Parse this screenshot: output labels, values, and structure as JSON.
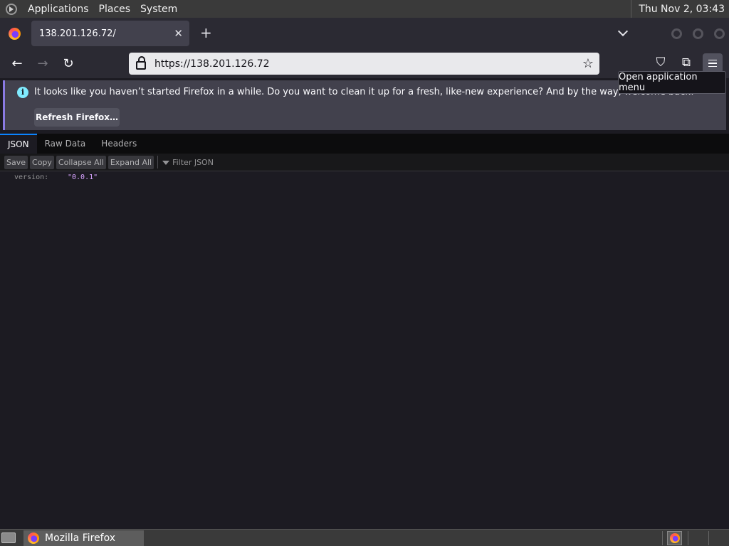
{
  "system_panel": {
    "menus": [
      "Applications",
      "Places",
      "System"
    ],
    "clock": "Thu Nov  2, 03:43"
  },
  "browser": {
    "tab_title": "138.201.126.72/",
    "tab_close": "✕",
    "new_tab": "+",
    "url": "https://138.201.126.72",
    "tooltip": "Open application menu",
    "notification": {
      "message": "It looks like you haven’t started Firefox in a while. Do you want to clean it up for a fresh, like-new experience? And by the way, welcome back!",
      "button_label": "Refresh Firefox…"
    }
  },
  "json_viewer": {
    "tabs": [
      "JSON",
      "Raw Data",
      "Headers"
    ],
    "active_tab": "JSON",
    "toolbar": [
      "Save",
      "Copy",
      "Collapse All",
      "Expand All"
    ],
    "filter_placeholder": "Filter JSON",
    "rows": [
      {
        "key": "version:",
        "value": "\"0.0.1\""
      }
    ]
  },
  "taskbar": {
    "window_title": "Mozilla Firefox"
  },
  "colors": {
    "accent": "#0a84ff",
    "string_value": "#d7a3ff",
    "notification_stripe": "#8a7ae2"
  }
}
